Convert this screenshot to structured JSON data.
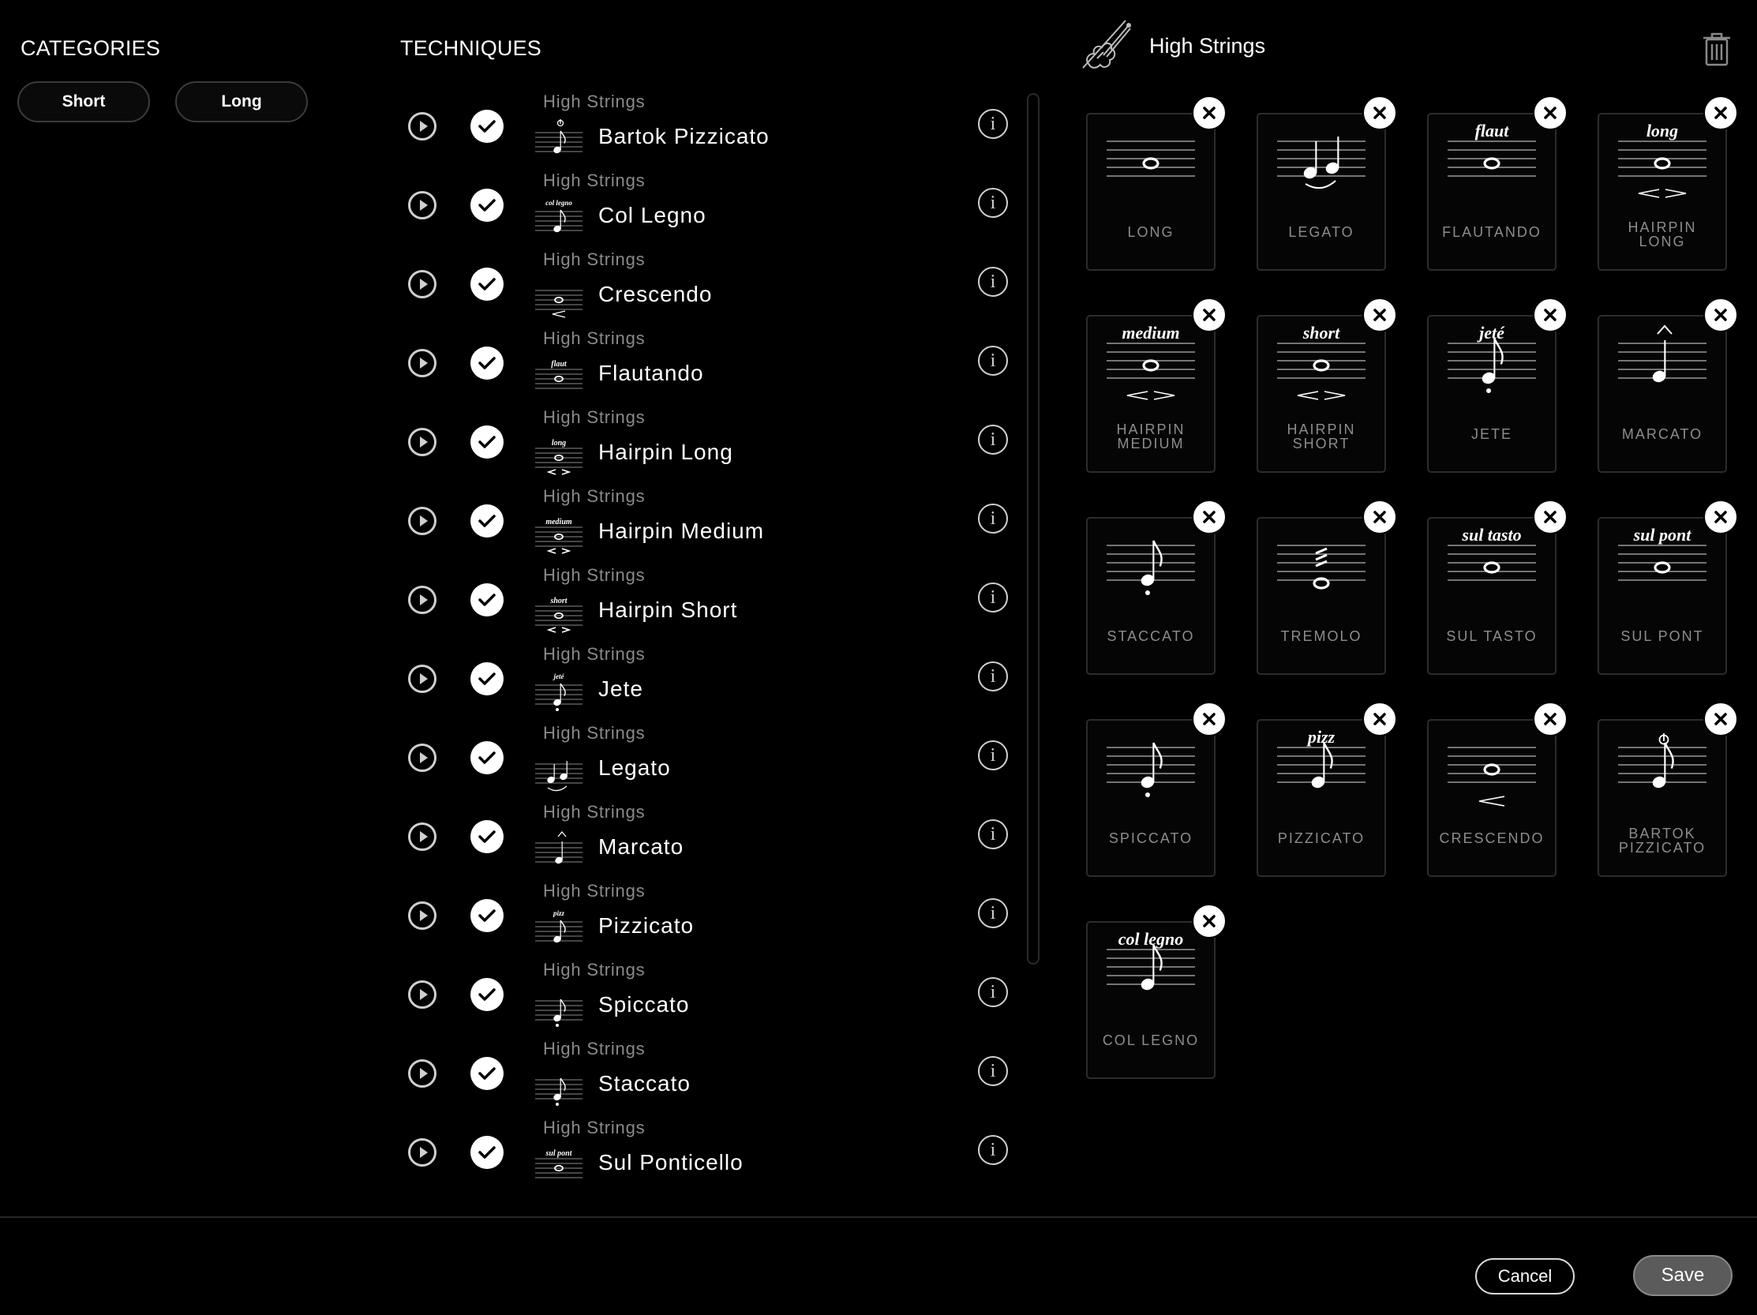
{
  "categories": {
    "title": "CATEGORIES",
    "buttons": [
      "Short",
      "Long"
    ]
  },
  "techniques": {
    "title": "TECHNIQUES",
    "items": [
      {
        "category": "High Strings",
        "name": "Bartok Pizzicato",
        "checked": true,
        "notation": "bartok"
      },
      {
        "category": "High Strings",
        "name": "Col Legno",
        "checked": true,
        "notation": "col legno"
      },
      {
        "category": "High Strings",
        "name": "Crescendo",
        "checked": true,
        "notation": "crescendo"
      },
      {
        "category": "High Strings",
        "name": "Flautando",
        "checked": true,
        "notation": "flaut"
      },
      {
        "category": "High Strings",
        "name": "Hairpin Long",
        "checked": true,
        "notation": "long"
      },
      {
        "category": "High Strings",
        "name": "Hairpin Medium",
        "checked": true,
        "notation": "medium"
      },
      {
        "category": "High Strings",
        "name": "Hairpin Short",
        "checked": true,
        "notation": "short"
      },
      {
        "category": "High Strings",
        "name": "Jete",
        "checked": true,
        "notation": "jeté"
      },
      {
        "category": "High Strings",
        "name": "Legato",
        "checked": true,
        "notation": "legato"
      },
      {
        "category": "High Strings",
        "name": "Marcato",
        "checked": true,
        "notation": "marcato"
      },
      {
        "category": "High Strings",
        "name": "Pizzicato",
        "checked": true,
        "notation": "pizz"
      },
      {
        "category": "High Strings",
        "name": "Spiccato",
        "checked": true,
        "notation": "spiccato"
      },
      {
        "category": "High Strings",
        "name": "Staccato",
        "checked": true,
        "notation": "staccato"
      },
      {
        "category": "High Strings",
        "name": "Sul Ponticello",
        "checked": true,
        "notation": "sul pont"
      }
    ]
  },
  "panel": {
    "title": "High Strings",
    "instrument_icon": "violin-icon",
    "delete_icon": "trash-icon",
    "cards": [
      {
        "label": [
          "LONG"
        ],
        "notation": "long-note",
        "marking": ""
      },
      {
        "label": [
          "LEGATO"
        ],
        "notation": "legato",
        "marking": ""
      },
      {
        "label": [
          "FLAUTANDO"
        ],
        "notation": "whole",
        "marking": "flaut"
      },
      {
        "label": [
          "HAIRPIN",
          "LONG"
        ],
        "notation": "whole-hairpin",
        "marking": "long"
      },
      {
        "label": [
          "HAIRPIN",
          "MEDIUM"
        ],
        "notation": "whole-hairpin",
        "marking": "medium"
      },
      {
        "label": [
          "HAIRPIN",
          "SHORT"
        ],
        "notation": "whole-hairpin",
        "marking": "short"
      },
      {
        "label": [
          "JETE"
        ],
        "notation": "eighth-dot",
        "marking": "jeté"
      },
      {
        "label": [
          "MARCATO"
        ],
        "notation": "marcato",
        "marking": ""
      },
      {
        "label": [
          "STACCATO"
        ],
        "notation": "eighth-dot",
        "marking": ""
      },
      {
        "label": [
          "TREMOLO"
        ],
        "notation": "tremolo",
        "marking": ""
      },
      {
        "label": [
          "SUL TASTO"
        ],
        "notation": "whole",
        "marking": "sul tasto"
      },
      {
        "label": [
          "SUL PONT"
        ],
        "notation": "whole",
        "marking": "sul pont"
      },
      {
        "label": [
          "SPICCATO"
        ],
        "notation": "eighth-dot",
        "marking": ""
      },
      {
        "label": [
          "PIZZICATO"
        ],
        "notation": "eighth",
        "marking": "pizz"
      },
      {
        "label": [
          "CRESCENDO"
        ],
        "notation": "whole-cresc",
        "marking": ""
      },
      {
        "label": [
          "BARTOK",
          "PIZZICATO"
        ],
        "notation": "bartok",
        "marking": ""
      },
      {
        "label": [
          "COL LEGNO"
        ],
        "notation": "eighth",
        "marking": "col legno"
      }
    ]
  },
  "footer": {
    "cancel_label": "Cancel",
    "save_label": "Save"
  }
}
